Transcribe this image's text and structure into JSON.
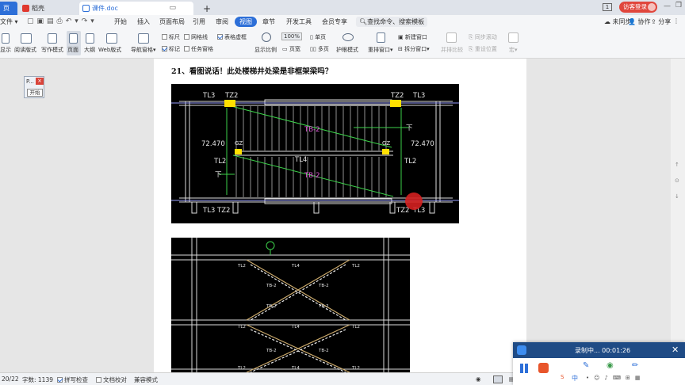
{
  "tabs": {
    "home": "页",
    "daoke": "稻壳",
    "doc": "课件.doc",
    "add": "+"
  },
  "window": {
    "badge": "1",
    "login": "访客登录"
  },
  "menu": {
    "file": "文件",
    "items": [
      "开始",
      "插入",
      "页面布局",
      "引用",
      "审阅",
      "视图",
      "章节",
      "开发工具",
      "会员专享"
    ],
    "active": "视图",
    "search": "查找命令、搜索模板",
    "unsync": "未同步",
    "collab": "协作",
    "share": "分享"
  },
  "ribbon": {
    "left_labels": [
      "显示",
      "阅读版式",
      "写作模式",
      "页面",
      "大纲",
      "Web版式"
    ],
    "nav_pane": "导航窗格",
    "checks": [
      {
        "label": "标尺",
        "on": false
      },
      {
        "label": "网格线",
        "on": false
      },
      {
        "label": "表格虚框",
        "on": true
      },
      {
        "label": "标记",
        "on": true
      },
      {
        "label": "任务窗格",
        "on": false
      }
    ],
    "zoom_label": "显示比例",
    "zoom_value": "100%",
    "page_width": "页宽",
    "single": "单页",
    "multi": "多页",
    "eye": "护眼模式",
    "rearrange": "重排窗口",
    "new_window": "新建窗口",
    "split": "拆分窗口",
    "parallel": "并排比较",
    "sync_scroll": "同步滚动",
    "reset_pos": "重设位置",
    "macro": "宏"
  },
  "document": {
    "question": "21、看图说话！此处楼梯井处梁是非框架梁吗？"
  },
  "drawing1": {
    "labels": [
      "TL3",
      "TZ2",
      "TZ2",
      "TL3",
      "TB-2",
      "72.470",
      "GZ",
      "GZ",
      "72.470",
      "TL4",
      "TB-2",
      "TL2",
      "TL2",
      "下",
      "下",
      "TL3",
      "TZ2",
      "TZ2",
      "TL3"
    ]
  },
  "drawing2": {
    "labels": [
      "TL4",
      "TL2",
      "TL2",
      "TB-2",
      "TB-2",
      "TL4",
      "TL2",
      "TL2",
      "TB-2",
      "TB-2",
      "TL4",
      "TL2",
      "TL2",
      "TB-2",
      "TB-2"
    ]
  },
  "mini_toolbar": {
    "title": "P...",
    "button": "开始"
  },
  "status": {
    "page": "20/22",
    "words": "字数: 1139",
    "spell": "拼写检查",
    "proof": "文档校对",
    "compat": "兼容模式"
  },
  "recorder": {
    "status": "录制中... 00:01:26"
  },
  "ime": {
    "lang": "中"
  },
  "colors": {
    "accent": "#2d6fd8",
    "recorder_bar": "#1f4b85",
    "record_stop": "#e8552b",
    "cad_bg": "#000000",
    "cad_yellow": "#ffe000",
    "cad_green": "#3cd14a"
  }
}
